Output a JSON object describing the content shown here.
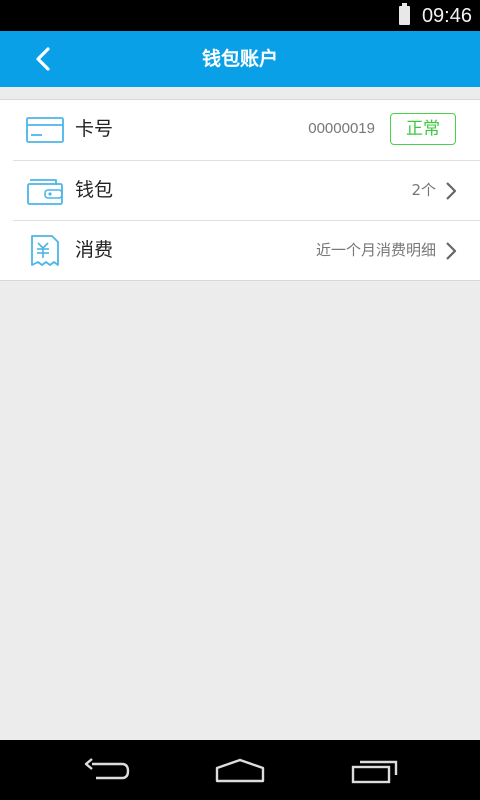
{
  "status_bar": {
    "time": "09:46"
  },
  "header": {
    "title": "钱包账户"
  },
  "rows": [
    {
      "label": "卡号",
      "value": "00000019",
      "badge": "正常"
    },
    {
      "label": "钱包",
      "value": "2个"
    },
    {
      "label": "消费",
      "value": "近一个月消费明细"
    }
  ],
  "colors": {
    "accent": "#0aa0e8",
    "badge": "#3cc83c",
    "icon": "#4bb6e8"
  },
  "icons": [
    "back-arrow-icon",
    "card-icon",
    "wallet-icon",
    "receipt-yen-icon",
    "chevron-right-icon",
    "nav-back-icon",
    "nav-home-icon",
    "nav-recents-icon"
  ]
}
